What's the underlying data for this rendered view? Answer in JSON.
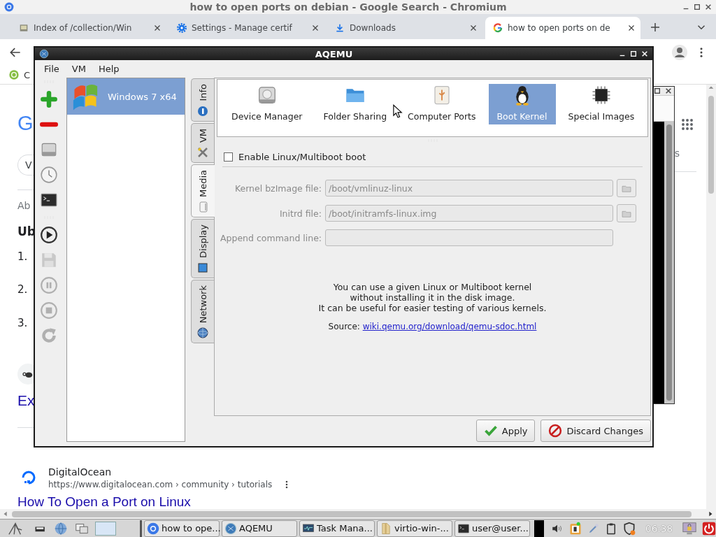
{
  "browser": {
    "title": "how to open ports on debian - Google Search - Chromium",
    "tabs": [
      {
        "label": "Index of /collection/Win",
        "kind": "page",
        "selected": false
      },
      {
        "label": "Settings - Manage certif",
        "kind": "settings",
        "selected": false
      },
      {
        "label": "Downloads",
        "kind": "downloads",
        "selected": false
      },
      {
        "label": "how to open ports on de",
        "kind": "google",
        "selected": true
      }
    ],
    "bookmarks": [
      {
        "label": "C"
      }
    ],
    "page": {
      "logo": "G",
      "chip": "V",
      "about": "Ab",
      "heading": "Ub",
      "steps": [
        "1.",
        "2.",
        "3."
      ],
      "link": "Ex",
      "side_text": "s",
      "result": {
        "site": "DigitalOcean",
        "url": "https://www.digitalocean.com › community › tutorials",
        "title": "How To Open a Port on Linux"
      }
    }
  },
  "aqemu": {
    "title": "AQEMU",
    "menu": [
      "File",
      "VM",
      "Help"
    ],
    "toolbar": [
      {
        "kind": "add",
        "disabled": false
      },
      {
        "kind": "remove",
        "disabled": false
      },
      {
        "kind": "drive",
        "disabled": false
      },
      {
        "kind": "clock",
        "disabled": false
      },
      {
        "kind": "terminal",
        "disabled": false
      },
      {
        "kind": "play",
        "disabled": false
      },
      {
        "kind": "save",
        "disabled": true
      },
      {
        "kind": "pause",
        "disabled": true
      },
      {
        "kind": "stop",
        "disabled": true
      },
      {
        "kind": "reload",
        "disabled": true
      }
    ],
    "vms": [
      {
        "name": "Windows 7 x64",
        "selected": true
      }
    ],
    "side_tabs": [
      {
        "label": "Info",
        "kind": "info",
        "selected": false
      },
      {
        "label": "VM",
        "kind": "vm",
        "selected": false
      },
      {
        "label": "Media",
        "kind": "media",
        "selected": true
      },
      {
        "label": "Display",
        "kind": "display",
        "selected": false
      },
      {
        "label": "Network",
        "kind": "network",
        "selected": false
      }
    ],
    "pages": [
      {
        "label": "Device Manager",
        "kind": "drive",
        "selected": false
      },
      {
        "label": "Folder Sharing",
        "kind": "folder",
        "selected": false
      },
      {
        "label": "Computer Ports",
        "kind": "usb",
        "selected": false
      },
      {
        "label": "Boot Kernel",
        "kind": "penguin",
        "selected": true
      },
      {
        "label": "Special Images",
        "kind": "chip",
        "selected": false
      }
    ],
    "boot": {
      "enable_label": "Enable Linux/Multiboot boot",
      "checked": false,
      "fields": [
        {
          "label": "Kernel bzImage file:",
          "value": "/boot/vmlinuz-linux",
          "browse": true
        },
        {
          "label": "Initrd file:",
          "value": "/boot/initramfs-linux.img",
          "browse": true
        },
        {
          "label": "Append command line:",
          "browse": false
        }
      ],
      "info": [
        "You can use a given Linux or Multiboot kernel",
        "without installing it in the disk image.",
        "It can be useful for easier testing of various kernels."
      ],
      "source_label": "Source:",
      "source_link": "wiki.qemu.org/download/qemu-sdoc.html"
    },
    "buttons": [
      {
        "label": "Apply",
        "kind": "apply"
      },
      {
        "label": "Discard Changes",
        "kind": "discard"
      }
    ]
  },
  "taskbar": {
    "tasks": [
      {
        "label": "how to ope...",
        "kind": "chromium"
      },
      {
        "label": "AQEMU",
        "kind": "qemu"
      },
      {
        "label": "Task Mana...",
        "kind": "monitor"
      },
      {
        "label": "virtio-win-...",
        "kind": "folder"
      },
      {
        "label": "user@user...",
        "kind": "terminal"
      }
    ],
    "clock": "06:38"
  }
}
